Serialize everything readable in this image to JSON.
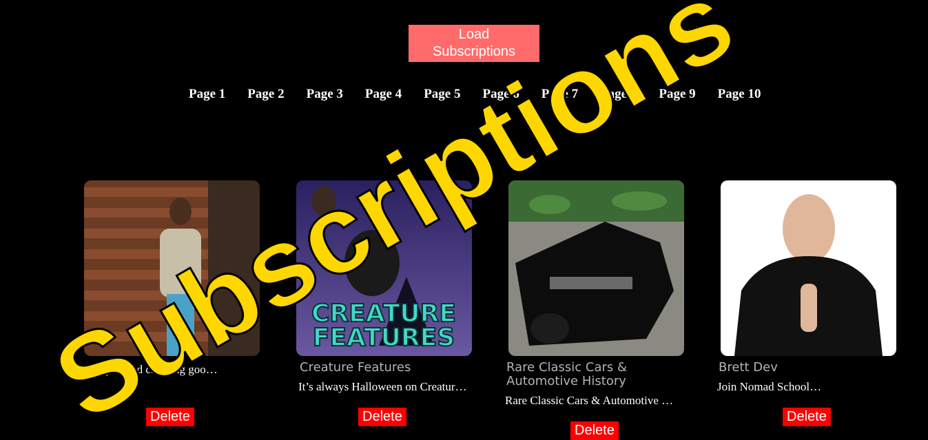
{
  "header_text": "",
  "load_button": "Load Subscriptions",
  "pages": [
    "Page 1",
    "Page 2",
    "Page 3",
    "Page 4",
    "Page 5",
    "Page 6",
    "Page 7",
    "Page 8",
    "Page 9",
    "Page 10"
  ],
  "cards": [
    {
      "title": "",
      "description": "…style, and catching goo…",
      "delete_label": "Delete"
    },
    {
      "title": "Creature Features",
      "description": "It’s always Halloween on Creatur…",
      "delete_label": "Delete",
      "thumb_text": "CREATURE FEATURES"
    },
    {
      "title": "Rare Classic Cars & Automotive History",
      "description": "Rare Classic Cars & Automotive …",
      "delete_label": "Delete"
    },
    {
      "title": "Brett Dev",
      "description": "Join Nomad School…",
      "delete_label": "Delete"
    }
  ],
  "watermark_text": "Subscriptions",
  "colors": {
    "load_button": "#ff6b6b",
    "delete_button": "#ff0000",
    "watermark": "#ffd700",
    "title_gray": "#b3b3b3"
  }
}
